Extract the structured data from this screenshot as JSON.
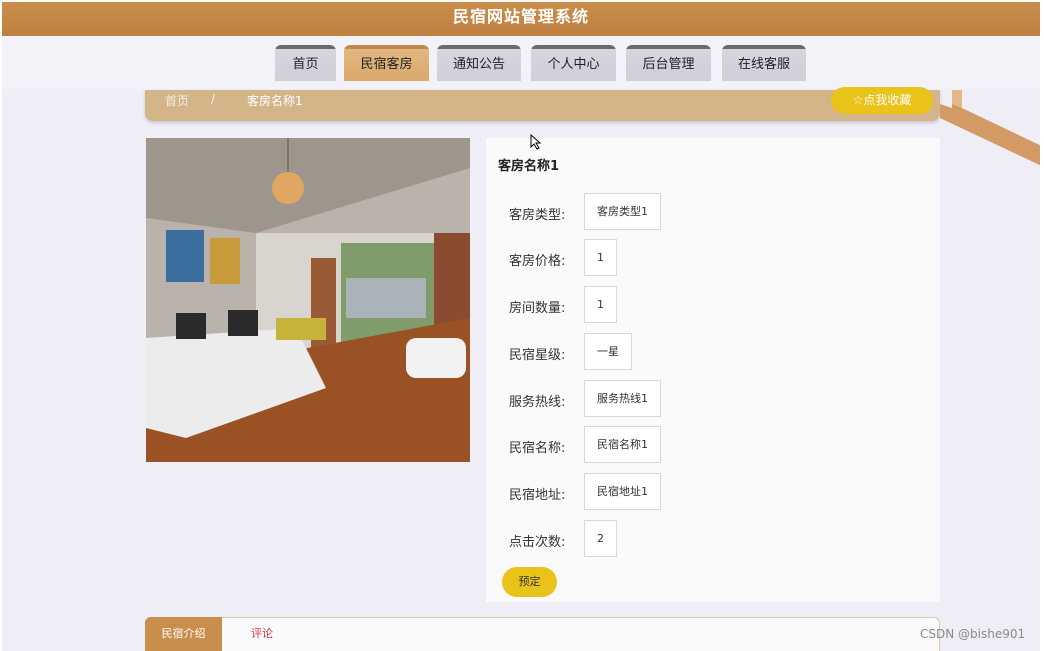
{
  "header": {
    "title": "民宿网站管理系统"
  },
  "nav": {
    "items": [
      {
        "label": "首页"
      },
      {
        "label": "民宿客房"
      },
      {
        "label": "通知公告"
      },
      {
        "label": "个人中心"
      },
      {
        "label": "后台管理"
      },
      {
        "label": "在线客服"
      }
    ],
    "active_index": 1
  },
  "breadcrumb": {
    "home": "首页",
    "separator": "/",
    "current": "客房名称1",
    "favorite_button": "☆点我收藏"
  },
  "detail": {
    "title": "客房名称1",
    "fields": [
      {
        "label": "客房类型:",
        "value": "客房类型1"
      },
      {
        "label": "客房价格:",
        "value": "1"
      },
      {
        "label": "房间数量:",
        "value": "1"
      },
      {
        "label": "民宿星级:",
        "value": "一星"
      },
      {
        "label": "服务热线:",
        "value": "服务热线1"
      },
      {
        "label": "民宿名称:",
        "value": "民宿名称1"
      },
      {
        "label": "民宿地址:",
        "value": "民宿地址1"
      },
      {
        "label": "点击次数:",
        "value": "2"
      }
    ],
    "book_button": "预定"
  },
  "tabs": [
    {
      "label": "民宿介绍"
    },
    {
      "label": "评论"
    }
  ],
  "watermark": "CSDN @bishe901",
  "colors": {
    "brand": "#c98e4c",
    "accent_button": "#e9c21a",
    "breadcrumb_bg": "#d4b58a",
    "page_bg": "#efedf6"
  }
}
